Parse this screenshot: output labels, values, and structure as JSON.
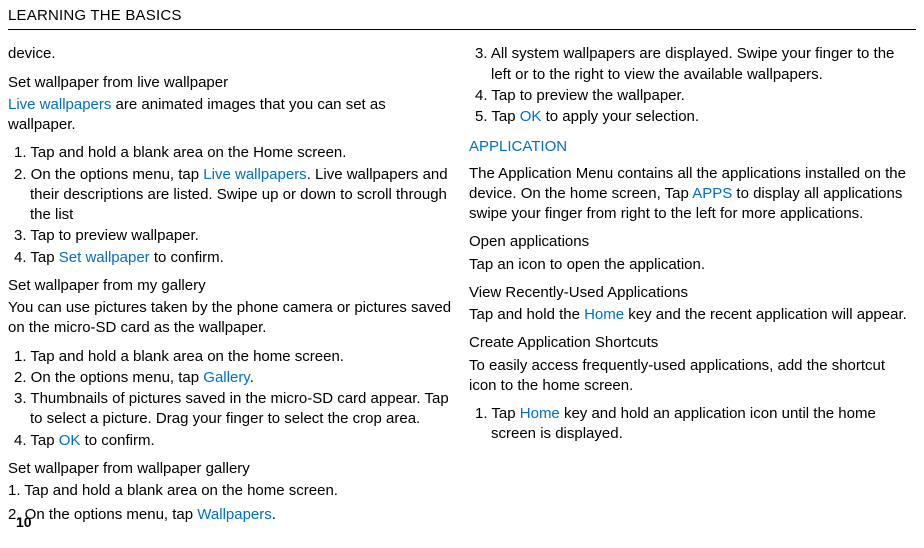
{
  "header": "LEARNING THE BASICS",
  "page_number": "10",
  "left": {
    "device_line": "device.",
    "s1_title": "Set wallpaper from live wallpaper",
    "s1_intro_a": "Live wallpapers",
    "s1_intro_b": " are animated images that you can set as wallpaper.",
    "s1_1": "1. Tap and hold a blank area on the Home screen.",
    "s1_2a": "2. On the options menu, tap ",
    "s1_2link": "Live wallpapers",
    "s1_2b": ". Live wallpapers and their descriptions are listed. Swipe up or down to scroll through the list",
    "s1_3": "3. Tap to preview wallpaper.",
    "s1_4a": "4. Tap ",
    "s1_4link": "Set wallpaper",
    "s1_4b": " to confirm.",
    "s2_title": "Set wallpaper from my gallery",
    "s2_intro": "You can use pictures taken by the phone camera or pictures saved on the micro-SD card as the wallpaper.",
    "s2_1": "1. Tap and hold a blank area on the home screen.",
    "s2_2a": "2. On the options menu, tap ",
    "s2_2link": "Gallery",
    "s2_2b": ".",
    "s2_3": "3. Thumbnails of pictures saved in the micro-SD card appear. Tap to select a picture. Drag your finger to select the crop area.",
    "s2_4a": "4. Tap ",
    "s2_4link": "OK",
    "s2_4b": " to confirm.",
    "s3_title": "Set wallpaper from wallpaper gallery",
    "s3_1": "1. Tap and hold a blank area on the home screen.",
    "s3_2a": "2. On the options menu, tap ",
    "s3_2link": "Wallpapers",
    "s3_2b": "."
  },
  "right": {
    "r1_3": "3. All system wallpapers are displayed. Swipe your finger to the left or to the right to view the available wallpapers.",
    "r1_4": "4. Tap to preview the wallpaper.",
    "r1_5a": "5. Tap ",
    "r1_5link": "OK",
    "r1_5b": " to apply your selection.",
    "app_title": "APPLICATION",
    "app_pa": "The Application Menu contains all the applications installed on the device. On the home screen, Tap ",
    "app_link": "APPS",
    "app_pb": " to display all applications swipe your finger from right to the left for more applications.",
    "open_title": "Open applications",
    "open_body": "Tap an icon to open the application.",
    "recent_title": "View Recently-Used Applications",
    "recent_a": "Tap and hold the ",
    "recent_link": "Home",
    "recent_b": " key and the recent application will appear.",
    "shortcut_title": "Create Application Shortcuts",
    "shortcut_body": "To easily access frequently-used applications, add the shortcut icon to the home screen.",
    "sc1a": "1. Tap ",
    "sc1link": "Home",
    "sc1b": " key and hold an application icon until the home screen is displayed."
  }
}
